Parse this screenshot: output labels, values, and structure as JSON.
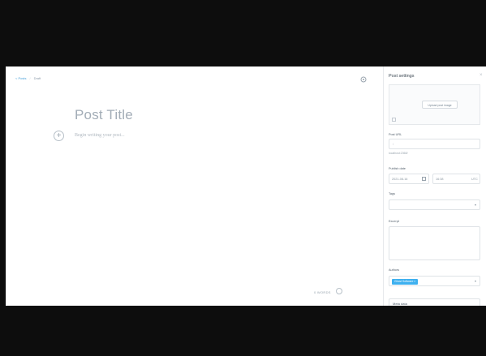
{
  "breadcrumbs": {
    "back": "< Posts",
    "sep": "/",
    "current": "Draft"
  },
  "editor": {
    "title_placeholder": "Post Title",
    "body_placeholder": "Begin writing your post...",
    "plus_icon": "+",
    "word_count": "0 WORDS"
  },
  "sidebar": {
    "title": "Post settings",
    "close_icon": "×",
    "upload_button": "Upload post image",
    "post_url_label": "Post URL",
    "post_url_placeholder": "/",
    "post_url_hint": "localhost:2368/",
    "publish_date_label": "Publish date",
    "publish_date": "2021-08-16",
    "publish_time": "16:38",
    "timezone": "UTC",
    "tags_label": "Tags",
    "excerpt_label": "Excerpt",
    "authors_label": "Authors",
    "author_tag": "Ghost Software ×",
    "bottom_item": "Meta data"
  }
}
